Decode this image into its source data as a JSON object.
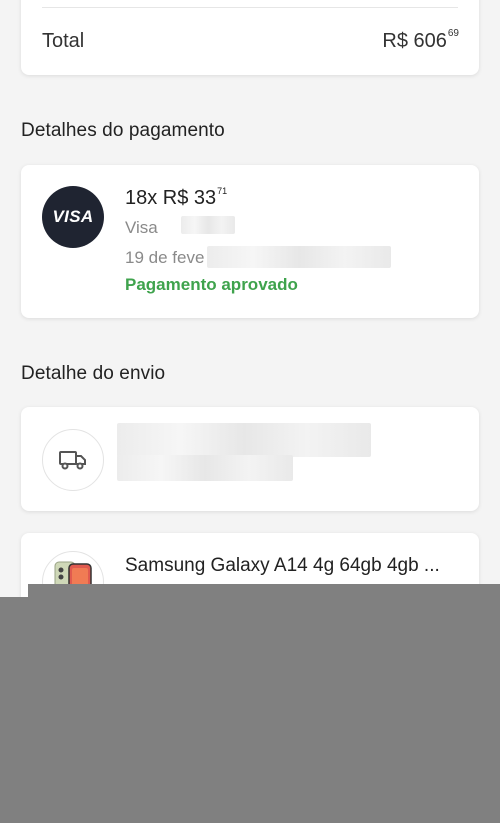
{
  "summary": {
    "total_label": "Total",
    "total_amount": "R$ 606",
    "total_cents": "69"
  },
  "payment": {
    "section_title": "Detalhes do pagamento",
    "card_brand": "VISA",
    "installments": "18x R$ 33",
    "installments_cents": "71",
    "card_line": "Visa",
    "date_line": "19 de feve",
    "status": "Pagamento aprovado",
    "status_color": "#3fa34d"
  },
  "shipping": {
    "section_title": "Detalhe do envio",
    "icon": "truck-icon"
  },
  "product": {
    "title": "Samsung Galaxy A14 4g 64gb 4gb ...",
    "icon": "phone-thumbnail"
  },
  "colors": {
    "visa_bg": "#1f2431",
    "background": "#f4f4f4",
    "overlay": "#808080"
  }
}
